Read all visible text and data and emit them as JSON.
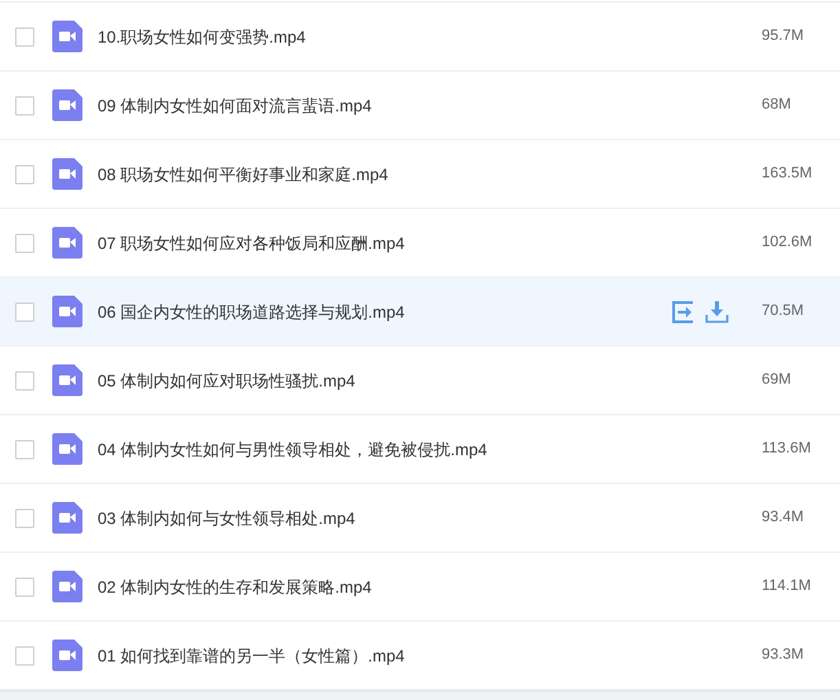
{
  "files": [
    {
      "name": "10.职场女性如何变强势.mp4",
      "size": "95.7M",
      "checked": false,
      "highlighted": false
    },
    {
      "name": "09 体制内女性如何面对流言蜚语.mp4",
      "size": "68M",
      "checked": false,
      "highlighted": false
    },
    {
      "name": "08 职场女性如何平衡好事业和家庭.mp4",
      "size": "163.5M",
      "checked": false,
      "highlighted": false
    },
    {
      "name": "07 职场女性如何应对各种饭局和应酬.mp4",
      "size": "102.6M",
      "checked": false,
      "highlighted": false
    },
    {
      "name": "06 国企内女性的职场道路选择与规划.mp4",
      "size": "70.5M",
      "checked": false,
      "highlighted": true
    },
    {
      "name": "05 体制内如何应对职场性骚扰.mp4",
      "size": "69M",
      "checked": false,
      "highlighted": false
    },
    {
      "name": "04 体制内女性如何与男性领导相处，避免被侵扰.mp4",
      "size": "113.6M",
      "checked": false,
      "highlighted": false
    },
    {
      "name": "03 体制内如何与女性领导相处.mp4",
      "size": "93.4M",
      "checked": false,
      "highlighted": false
    },
    {
      "name": "02 体制内女性的生存和发展策略.mp4",
      "size": "114.1M",
      "checked": false,
      "highlighted": false
    },
    {
      "name": "01 如何找到靠谱的另一半（女性篇）.mp4",
      "size": "93.3M",
      "checked": false,
      "highlighted": false
    }
  ]
}
